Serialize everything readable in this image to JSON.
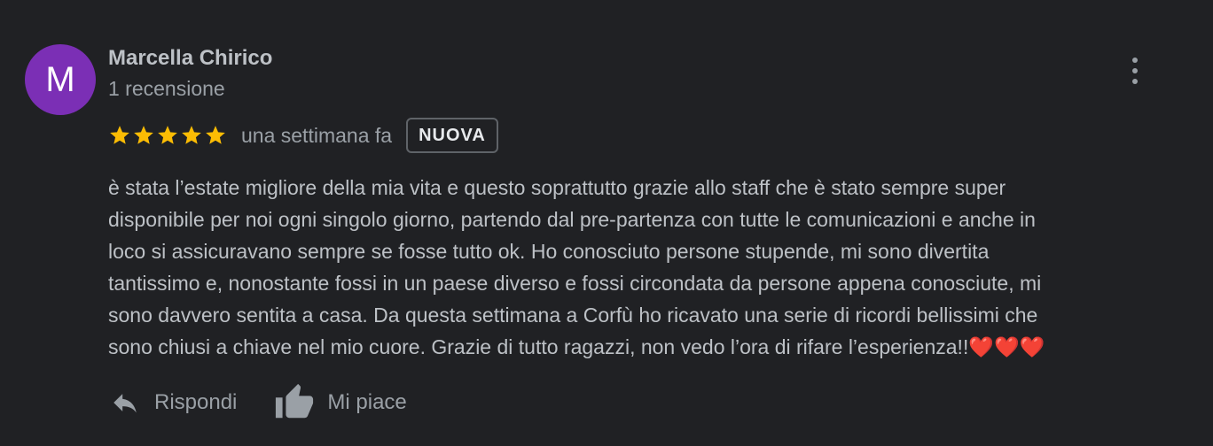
{
  "review": {
    "avatar_letter": "M",
    "author_name": "Marcella Chirico",
    "review_count": "1 recensione",
    "rating": 5,
    "star_color": "#fbbc04",
    "date": "una settimana fa",
    "badge": "NUOVA",
    "text": "è stata l’estate migliore della mia vita e questo soprattutto grazie allo staff che è stato sempre super\ndisponibile per noi ogni singolo giorno, partendo dal pre-partenza con tutte le comunicazioni e anche in\nloco si assicuravano sempre se fosse tutto ok. Ho conosciuto persone stupende, mi sono divertita\ntantissimo e, nonostante fossi in un paese diverso e fossi circondata da persone appena conosciute, mi\nsono davvero sentita a casa. Da questa settimana a Corfù ho ricavato una serie di ricordi bellissimi che\nsono chiusi a chiave nel mio cuore. Grazie di tutto ragazzi, non vedo l’ora di rifare l’esperienza!!❤️❤️❤️"
  },
  "actions": {
    "reply_label": "Rispondi",
    "like_label": "Mi piace"
  },
  "icons": {
    "more": "more-vert-icon",
    "reply": "reply-icon",
    "like": "thumb-up-icon",
    "star": "star-icon"
  },
  "colors": {
    "background": "#202124",
    "avatar": "#7b2fb5"
  }
}
